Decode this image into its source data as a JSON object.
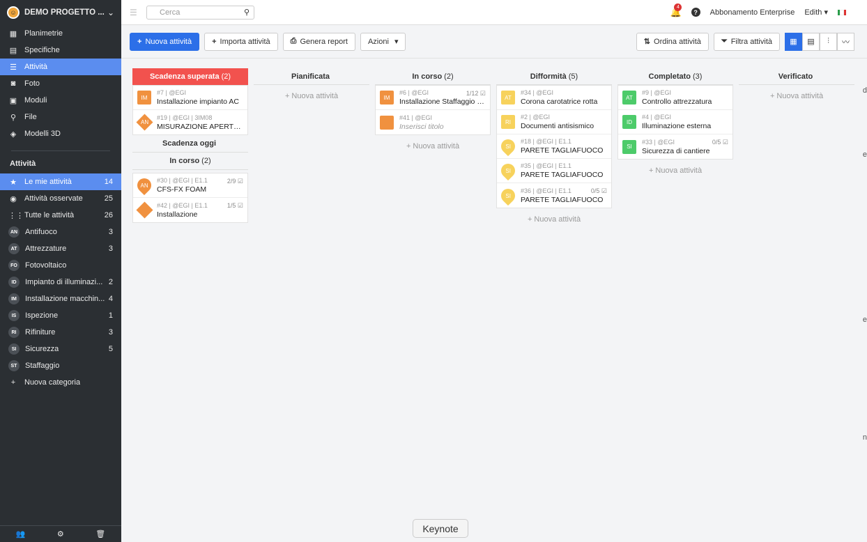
{
  "project": {
    "name": "DEMO PROGETTO ..."
  },
  "nav": [
    {
      "icon": "▦",
      "label": "Planimetrie"
    },
    {
      "icon": "▤",
      "label": "Specifiche"
    },
    {
      "icon": "☰",
      "label": "Attività",
      "active": true
    },
    {
      "icon": "◙",
      "label": "Foto"
    },
    {
      "icon": "▣",
      "label": "Moduli"
    },
    {
      "icon": "⚲",
      "label": "File"
    },
    {
      "icon": "◈",
      "label": "Modelli 3D"
    }
  ],
  "activities_section": "Attività",
  "activities": [
    {
      "icon": "★",
      "label": "Le mie attività",
      "count": "14",
      "active": true
    },
    {
      "icon": "◉",
      "label": "Attività osservate",
      "count": "25"
    },
    {
      "icon": "⋮⋮",
      "label": "Tutte le attività",
      "count": "26"
    },
    {
      "badge": "AN",
      "label": "Antifuoco",
      "count": "3"
    },
    {
      "badge": "AT",
      "label": "Attrezzature",
      "count": "3"
    },
    {
      "badge": "FO",
      "label": "Fotovoltaico",
      "count": ""
    },
    {
      "badge": "ID",
      "label": "Impianto di illuminazi...",
      "count": "2"
    },
    {
      "badge": "IM",
      "label": "Installazione macchin...",
      "count": "4"
    },
    {
      "badge": "IS",
      "label": "Ispezione",
      "count": "1"
    },
    {
      "badge": "RI",
      "label": "Rifiniture",
      "count": "3"
    },
    {
      "badge": "SI",
      "label": "Sicurezza",
      "count": "5"
    },
    {
      "badge": "ST",
      "label": "Staffaggio",
      "count": ""
    },
    {
      "icon": "+",
      "label": "Nuova categoria",
      "count": ""
    }
  ],
  "topbar": {
    "search_placeholder": "Cerca",
    "notifications": "4",
    "subscription": "Abbonamento Enterprise",
    "user": "Edith"
  },
  "toolbar": {
    "new_activity": "Nuova attività",
    "import": "Importa attività",
    "report": "Genera report",
    "actions": "Azioni",
    "sort": "Ordina attività",
    "filter": "Filtra attività"
  },
  "add_label": "+ Nuova attività",
  "columns": [
    {
      "title": "Scadenza superata",
      "count": "(2)",
      "overdue": true,
      "cards": [
        {
          "badge": "IM",
          "shape": "sq",
          "color": "#f0913f",
          "meta": "#7 | @EGI",
          "title": "Installazione impianto AC"
        },
        {
          "badge": "AN",
          "shape": "dia",
          "color": "#f0913f",
          "meta": "#19 | @EGI | 3IM08",
          "title": "MISURAZIONE APERTUR..."
        }
      ],
      "sub": [
        {
          "title": "Scadenza oggi",
          "count": "",
          "cards": []
        },
        {
          "title": "In corso",
          "count": "(2)",
          "cards": [
            {
              "badge": "AN",
              "shape": "pin",
              "color": "#f0913f",
              "meta": "#30 | @EGI | E1.1",
              "title": "CFS-FX FOAM",
              "prog": "2/9 ☑"
            },
            {
              "badge": "",
              "shape": "dia",
              "color": "#f0913f",
              "meta": "#42 | @EGI | E1.1",
              "title": "Installazione",
              "prog": "1/5 ☑"
            }
          ]
        }
      ]
    },
    {
      "title": "Pianificata",
      "count": "",
      "cards": []
    },
    {
      "title": "In corso",
      "count": "(2)",
      "cards": [
        {
          "badge": "IM",
          "shape": "sq",
          "color": "#f0913f",
          "meta": "#6 | @EGI",
          "title": "Installazione Staffaggio - M...",
          "prog": "1/12 ☑"
        },
        {
          "badge": "",
          "shape": "sq",
          "color": "#f0913f",
          "meta": "#41 | @EGI",
          "title": "Inserisci titolo",
          "placeholder": true
        }
      ]
    },
    {
      "title": "Difformità",
      "count": "(5)",
      "cards": [
        {
          "badge": "AT",
          "shape": "sq",
          "color": "#f7d25c",
          "meta": "#34 | @EGI",
          "title": "Corona carotatrice rotta"
        },
        {
          "badge": "RI",
          "shape": "sq",
          "color": "#f7d25c",
          "meta": "#2 | @EGI",
          "title": "Documenti antisismico"
        },
        {
          "badge": "SI",
          "shape": "pin",
          "color": "#f7d25c",
          "meta": "#18 | @EGI | E1.1",
          "title": "PARETE TAGLIAFUOCO"
        },
        {
          "badge": "SI",
          "shape": "pin",
          "color": "#f7d25c",
          "meta": "#35 | @EGI | E1.1",
          "title": "PARETE TAGLIAFUOCO"
        },
        {
          "badge": "SI",
          "shape": "pin",
          "color": "#f7d25c",
          "meta": "#36 | @EGI | E1.1",
          "title": "PARETE TAGLIAFUOCO",
          "prog": "0/5 ☑"
        }
      ]
    },
    {
      "title": "Completato",
      "count": "(3)",
      "cards": [
        {
          "badge": "AT",
          "shape": "sq",
          "color": "#4dcb6a",
          "meta": "#9 | @EGI",
          "title": "Controllo attrezzatura"
        },
        {
          "badge": "ID",
          "shape": "sq",
          "color": "#4dcb6a",
          "meta": "#4 | @EGI",
          "title": "Illuminazione esterna"
        },
        {
          "badge": "SI",
          "shape": "sq",
          "color": "#4dcb6a",
          "meta": "#33 | @EGI",
          "title": "Sicurezza di cantiere",
          "prog": "0/5 ☑"
        }
      ]
    },
    {
      "title": "Verificato",
      "count": "",
      "cards": []
    }
  ],
  "toast": "Keynote",
  "edge_letters": [
    "d",
    "e",
    "e",
    "n"
  ]
}
